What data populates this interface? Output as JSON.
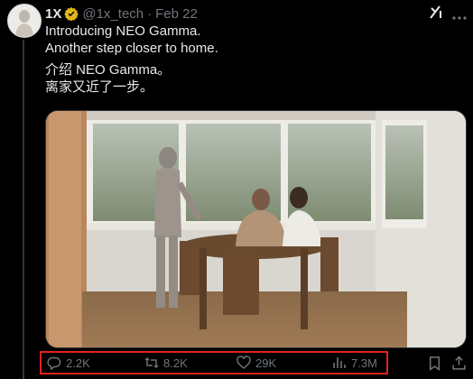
{
  "tweet": {
    "author_name": "1X",
    "handle": "@1x_tech",
    "separator": "·",
    "date": "Feb 22",
    "lines": [
      "Introducing NEO Gamma.",
      "Another step closer to home.",
      "介绍 NEO Gamma。",
      "离家又近了一步。"
    ]
  },
  "actions": {
    "replies": "2.2K",
    "reposts": "8.2K",
    "likes": "29K",
    "views": "7.3M"
  },
  "icons": {
    "verified": "verified-badge-icon",
    "grok": "grok-icon",
    "more": "more-icon",
    "reply": "reply-icon",
    "repost": "repost-icon",
    "like": "heart-icon",
    "views": "views-chart-icon",
    "bookmark": "bookmark-icon",
    "share": "share-icon"
  },
  "colors": {
    "background": "#000000",
    "text": "#e7e9ea",
    "muted": "#71767b",
    "verified_gold": "#e2b719",
    "highlight_box": "#e0241a"
  }
}
